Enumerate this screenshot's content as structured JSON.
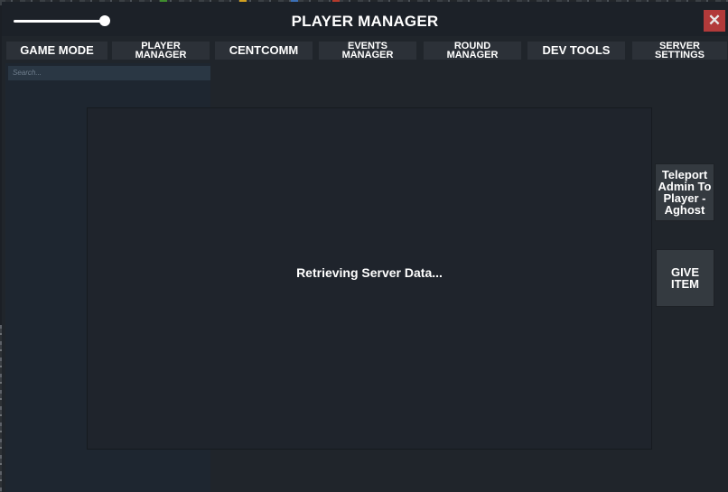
{
  "window": {
    "title": "PLAYER MANAGER",
    "close_symbol": "✕"
  },
  "tabs": [
    {
      "label": "GAME MODE"
    },
    {
      "label": "PLAYER\nMANAGER"
    },
    {
      "label": "CENTCOMM"
    },
    {
      "label": "EVENTS\nMANAGER"
    },
    {
      "label": "ROUND\nMANAGER"
    },
    {
      "label": "DEV TOOLS"
    },
    {
      "label": "SERVER\nSETTINGS"
    }
  ],
  "sidebar": {
    "search_placeholder": "Search..."
  },
  "content": {
    "status_text": "Retrieving Server Data..."
  },
  "actions": {
    "teleport_label": "Teleport\nAdmin To\nPlayer -\nAghost",
    "give_item_label": "GIVE\nITEM"
  },
  "colors": {
    "close_button": "#b23a3a",
    "panel_bg": "#20252b",
    "tab_bg": "#2c3138"
  }
}
